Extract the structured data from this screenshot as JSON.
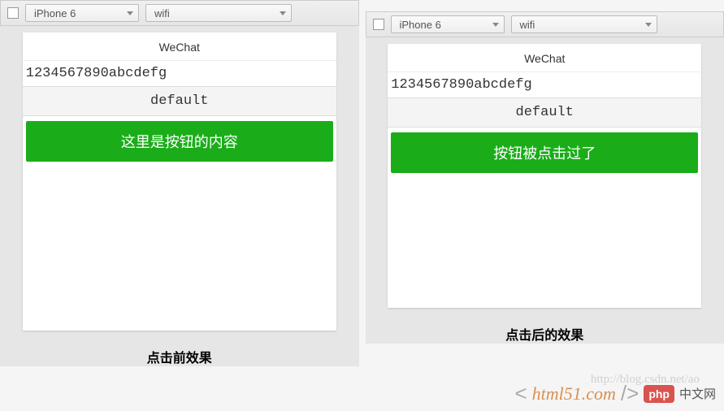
{
  "panels": {
    "left": {
      "toolbar": {
        "device": "iPhone 6",
        "network": "wifi"
      },
      "phone": {
        "title": "WeChat",
        "text1": "1234567890abcdefg",
        "default": "default",
        "button": "这里是按钮的内容"
      },
      "caption": "点击前效果"
    },
    "right": {
      "toolbar": {
        "device": "iPhone 6",
        "network": "wifi"
      },
      "phone": {
        "title": "WeChat",
        "text1": "1234567890abcdefg",
        "default": "default",
        "button": "按钮被点击过了"
      },
      "caption": "点击后的效果"
    }
  },
  "watermark": {
    "url": "http://blog.csdn.net/ao",
    "brand": "html51.com",
    "phpbox": "php",
    "cn": "中文网"
  }
}
